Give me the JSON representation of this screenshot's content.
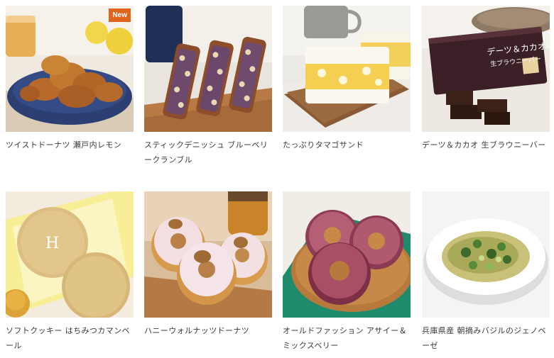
{
  "products": [
    {
      "name": "ツイストドーナツ 瀬戸内レモン",
      "badge": "New"
    },
    {
      "name": "スティックデニッシュ ブルーベリークランブル"
    },
    {
      "name": "たっぷりタマゴサンド"
    },
    {
      "name": "デーツ＆カカオ 生ブラウニーバー"
    },
    {
      "name": "ソフトクッキー はちみつカマンベール"
    },
    {
      "name": "ハニーウォルナッツドーナツ"
    },
    {
      "name": "オールドファッション アサイー＆ミックスベリー"
    },
    {
      "name": "兵庫県産 朝摘みバジルのジェノベーゼ"
    }
  ],
  "package_texts": {
    "brownie_title": "デーツ＆カカオ",
    "brownie_subtitle": "生ブラウニーバー",
    "cookie_logo": "H"
  },
  "colors": {
    "badge": "#e0631e",
    "text": "#3a3a3a"
  }
}
